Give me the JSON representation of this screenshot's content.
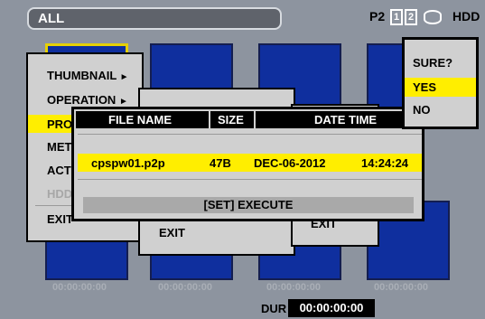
{
  "topbar": {
    "title": "ALL",
    "media_label": "P2",
    "slots": [
      "1",
      "2"
    ],
    "hdd_label": "HDD"
  },
  "timecodes": [
    "00:00:00:00",
    "00:00:00:00",
    "00:00:00:00",
    "00:00:00:00"
  ],
  "bottombar": {
    "dur_label": "DUR",
    "dur_value": "00:00:00:00"
  },
  "main_menu": {
    "items": [
      {
        "label": "THUMBNAIL",
        "arrow": "►"
      },
      {
        "label": "OPERATION",
        "arrow": "►"
      },
      {
        "label": "PRO"
      },
      {
        "label": "MET"
      },
      {
        "label": "ACT"
      },
      {
        "label": "HDD"
      },
      {
        "label": "EXIT"
      }
    ]
  },
  "sub_menu": {
    "exit_label": "EXIT"
  },
  "sub_menu_2": {
    "exit_label": "EXIT"
  },
  "dialog": {
    "columns": [
      "FILE NAME",
      "SIZE",
      "DATE TIME"
    ],
    "row": {
      "file_name": "cpspw01.p2p",
      "size": "47B",
      "date": "DEC-06-2012",
      "time": "14:24:24"
    },
    "execute_label": "[SET] EXECUTE"
  },
  "confirm": {
    "question": "SURE?",
    "yes": "YES",
    "no": "NO"
  },
  "colors": {
    "highlight": "#ffee00",
    "thumbnail": "#0f2f9e",
    "background": "#8d949f"
  }
}
